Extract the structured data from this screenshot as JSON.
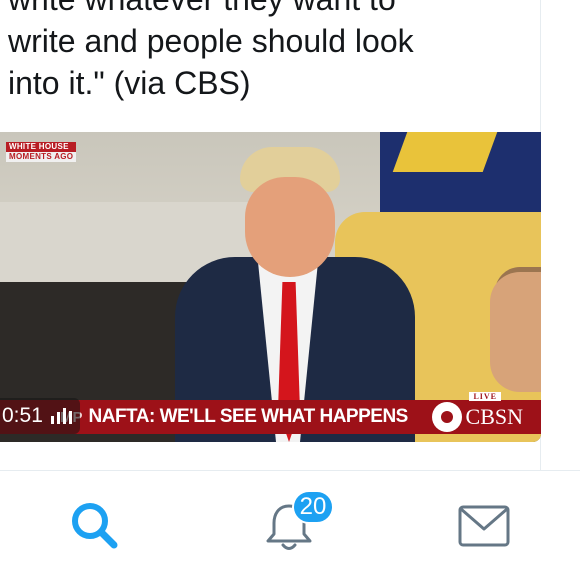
{
  "tweet": {
    "text": "write whatever they want to\nwrite and people should look\ninto it.\" (via CBS)"
  },
  "video": {
    "corner_tag_line1": "WHITE HOUSE",
    "corner_tag_line2": "MOMENTS AGO",
    "ticker_prefix": "MP",
    "headline": "NAFTA: WE'LL SEE WHAT HAPPENS",
    "network": "CBSN",
    "live_label": "LIVE",
    "duration": "0:51"
  },
  "tabbar": {
    "search_icon": "search-icon",
    "notifications_icon": "bell-icon",
    "notifications_count": "20",
    "messages_icon": "envelope-icon",
    "accent_color": "#1da1f2",
    "inactive_color": "#657786"
  }
}
